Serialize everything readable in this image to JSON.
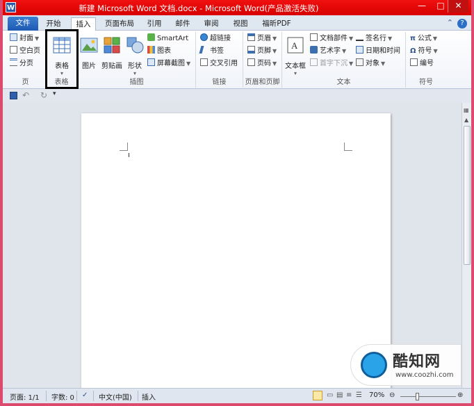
{
  "window": {
    "title": "新建 Microsoft Word 文档.docx - Microsoft Word(产品激活失败)"
  },
  "tabs": [
    {
      "label": "文件"
    },
    {
      "label": "开始"
    },
    {
      "label": "插入"
    },
    {
      "label": "页面布局"
    },
    {
      "label": "引用"
    },
    {
      "label": "邮件"
    },
    {
      "label": "审阅"
    },
    {
      "label": "视图"
    },
    {
      "label": "福昕PDF"
    }
  ],
  "ribbon": {
    "pages": {
      "label": "页",
      "items": [
        "封面",
        "空白页",
        "分页"
      ]
    },
    "tables": {
      "label": "表格",
      "button": "表格"
    },
    "illustrations": {
      "label": "插图",
      "picture": "图片",
      "clipart": "剪贴画",
      "shapes": "形状",
      "smartart": "SmartArt",
      "chart": "图表",
      "screenshot": "屏幕截图"
    },
    "links": {
      "label": "链接",
      "items": [
        "超链接",
        "书签",
        "交叉引用"
      ]
    },
    "header_footer": {
      "label": "页眉和页脚",
      "items": [
        "页眉",
        "页脚",
        "页码"
      ]
    },
    "text": {
      "label": "文本",
      "textbox": "文本框",
      "quickparts": "文档部件",
      "wordart": "艺术字",
      "dropcap": "首字下沉",
      "signature": "签名行",
      "datetime": "日期和时间",
      "object": "对象"
    },
    "symbols": {
      "label": "符号",
      "items": [
        "公式",
        "符号",
        "编号"
      ]
    }
  },
  "statusbar": {
    "page": "页面: 1/1",
    "words": "字数: 0",
    "language": "中文(中国)",
    "mode": "插入",
    "zoom": "70%"
  },
  "watermark": {
    "title": "酷知网",
    "url": "www.coozhi.com"
  },
  "colors": {
    "titlebar": "#e50000",
    "accent": "#2b70c7",
    "highlight_box": "#000000"
  }
}
